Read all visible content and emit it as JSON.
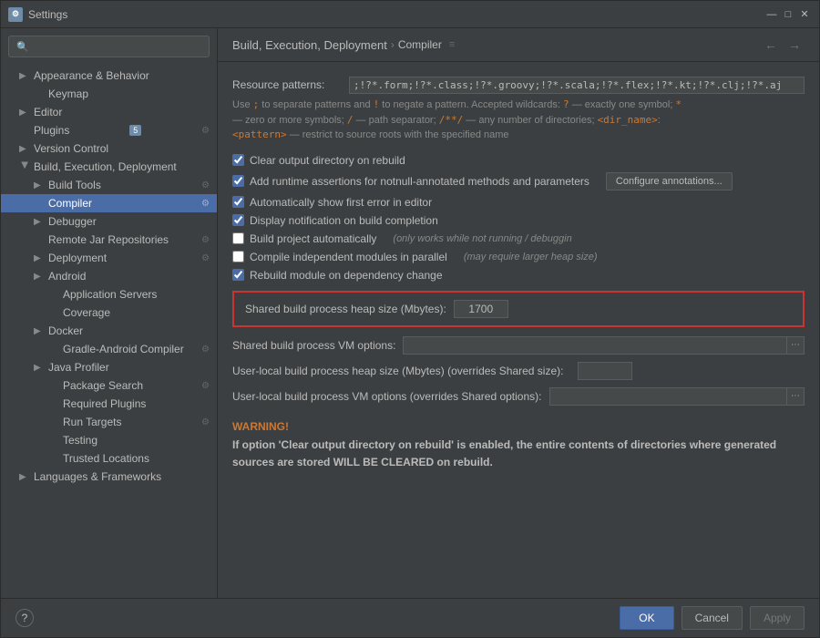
{
  "window": {
    "title": "Settings",
    "icon": "⚙"
  },
  "sidebar": {
    "search_placeholder": "",
    "items": [
      {
        "id": "appearance",
        "label": "Appearance & Behavior",
        "indent": 1,
        "has_arrow": true,
        "arrow_open": false,
        "active": false
      },
      {
        "id": "keymap",
        "label": "Keymap",
        "indent": 2,
        "has_arrow": false,
        "active": false
      },
      {
        "id": "editor",
        "label": "Editor",
        "indent": 1,
        "has_arrow": true,
        "arrow_open": false,
        "active": false
      },
      {
        "id": "plugins",
        "label": "Plugins",
        "indent": 1,
        "has_arrow": false,
        "active": false,
        "badge": "5",
        "settings_icon": true
      },
      {
        "id": "version-control",
        "label": "Version Control",
        "indent": 1,
        "has_arrow": true,
        "arrow_open": false,
        "active": false
      },
      {
        "id": "build-execution",
        "label": "Build, Execution, Deployment",
        "indent": 1,
        "has_arrow": true,
        "arrow_open": true,
        "active": false
      },
      {
        "id": "build-tools",
        "label": "Build Tools",
        "indent": 2,
        "has_arrow": true,
        "arrow_open": false,
        "active": false,
        "settings_icon": true
      },
      {
        "id": "compiler",
        "label": "Compiler",
        "indent": 2,
        "has_arrow": false,
        "active": true,
        "settings_icon": true
      },
      {
        "id": "debugger",
        "label": "Debugger",
        "indent": 2,
        "has_arrow": true,
        "arrow_open": false,
        "active": false
      },
      {
        "id": "remote-jar",
        "label": "Remote Jar Repositories",
        "indent": 2,
        "has_arrow": false,
        "active": false,
        "settings_icon": true
      },
      {
        "id": "deployment",
        "label": "Deployment",
        "indent": 2,
        "has_arrow": true,
        "arrow_open": false,
        "active": false,
        "settings_icon": true
      },
      {
        "id": "android",
        "label": "Android",
        "indent": 2,
        "has_arrow": true,
        "arrow_open": false,
        "active": false
      },
      {
        "id": "application-servers",
        "label": "Application Servers",
        "indent": 3,
        "has_arrow": false,
        "active": false
      },
      {
        "id": "coverage",
        "label": "Coverage",
        "indent": 3,
        "has_arrow": false,
        "active": false
      },
      {
        "id": "docker",
        "label": "Docker",
        "indent": 2,
        "has_arrow": true,
        "arrow_open": false,
        "active": false
      },
      {
        "id": "gradle-android",
        "label": "Gradle-Android Compiler",
        "indent": 3,
        "has_arrow": false,
        "active": false,
        "settings_icon": true
      },
      {
        "id": "java-profiler",
        "label": "Java Profiler",
        "indent": 2,
        "has_arrow": true,
        "arrow_open": false,
        "active": false
      },
      {
        "id": "package-search",
        "label": "Package Search",
        "indent": 3,
        "has_arrow": false,
        "active": false,
        "settings_icon": true
      },
      {
        "id": "required-plugins",
        "label": "Required Plugins",
        "indent": 3,
        "has_arrow": false,
        "active": false
      },
      {
        "id": "run-targets",
        "label": "Run Targets",
        "indent": 3,
        "has_arrow": false,
        "active": false,
        "settings_icon": true
      },
      {
        "id": "testing",
        "label": "Testing",
        "indent": 3,
        "has_arrow": false,
        "active": false
      },
      {
        "id": "trusted-locations",
        "label": "Trusted Locations",
        "indent": 3,
        "has_arrow": false,
        "active": false
      },
      {
        "id": "languages",
        "label": "Languages & Frameworks",
        "indent": 1,
        "has_arrow": true,
        "arrow_open": false,
        "active": false
      }
    ]
  },
  "header": {
    "breadcrumb": [
      "Build, Execution, Deployment",
      "Compiler"
    ],
    "breadcrumb_sep": "›",
    "header_icon": "≡"
  },
  "content": {
    "resource_patterns_label": "Resource patterns:",
    "resource_patterns_value": ";!?*.form;!?*.class;!?*.groovy;!?*.scala;!?*.flex;!?*.kt;!?*.clj;!?*.aj",
    "help_text": "Use ; to separate patterns and ! to negate a pattern. Accepted wildcards: ? — exactly one symbol; * — zero or more symbols; / — path separator; /**/ — any number of directories; <dir_name>: <pattern> — restrict to source roots with the specified name",
    "checkboxes": [
      {
        "id": "clear-output",
        "label": "Clear output directory on rebuild",
        "checked": true,
        "note": ""
      },
      {
        "id": "runtime-assertions",
        "label": "Add runtime assertions for notnull-annotated methods and parameters",
        "checked": true,
        "note": "",
        "has_btn": true,
        "btn_label": "Configure annotations..."
      },
      {
        "id": "show-first-error",
        "label": "Automatically show first error in editor",
        "checked": true,
        "note": ""
      },
      {
        "id": "display-notification",
        "label": "Display notification on build completion",
        "checked": true,
        "note": ""
      },
      {
        "id": "build-auto",
        "label": "Build project automatically",
        "checked": false,
        "note": "(only works while not running / debuggin"
      },
      {
        "id": "compile-parallel",
        "label": "Compile independent modules in parallel",
        "checked": false,
        "note": "(may require larger heap size)"
      },
      {
        "id": "rebuild-module",
        "label": "Rebuild module on dependency change",
        "checked": true,
        "note": ""
      }
    ],
    "heap_section": {
      "label": "Shared build process heap size (Mbytes):",
      "value": "1700"
    },
    "vm_options_label": "Shared build process VM options:",
    "user_heap_label": "User-local build process heap size (Mbytes) (overrides Shared size):",
    "user_vm_label": "User-local build process VM options (overrides Shared options):",
    "warning": {
      "title": "WARNING!",
      "text": "If option 'Clear output directory on rebuild' is enabled, the entire contents of directories where generated sources are stored WILL BE CLEARED on rebuild."
    }
  },
  "footer": {
    "ok_label": "OK",
    "cancel_label": "Cancel",
    "apply_label": "Apply"
  }
}
